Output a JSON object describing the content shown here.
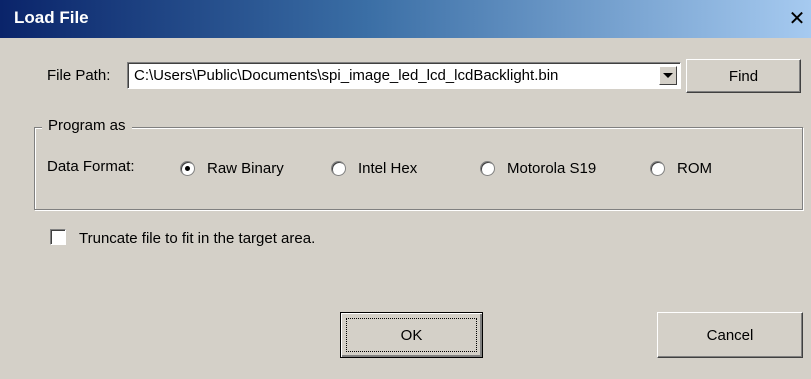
{
  "dialog": {
    "title": "Load File",
    "close_glyph": "✕"
  },
  "file_path": {
    "label": "File Path:",
    "value": "C:\\Users\\Public\\Documents\\spi_image_led_lcd_lcdBacklight.bin",
    "find_label": "Find"
  },
  "program_as": {
    "title": "Program as",
    "data_format_label": "Data Format:",
    "options": [
      {
        "label": "Raw Binary",
        "selected": true
      },
      {
        "label": "Intel Hex",
        "selected": false
      },
      {
        "label": "Motorola S19",
        "selected": false
      },
      {
        "label": "ROM",
        "selected": false
      }
    ]
  },
  "truncate": {
    "label": "Truncate file to fit in the target area.",
    "checked": false
  },
  "buttons": {
    "ok_label": "OK",
    "cancel_label": "Cancel"
  }
}
